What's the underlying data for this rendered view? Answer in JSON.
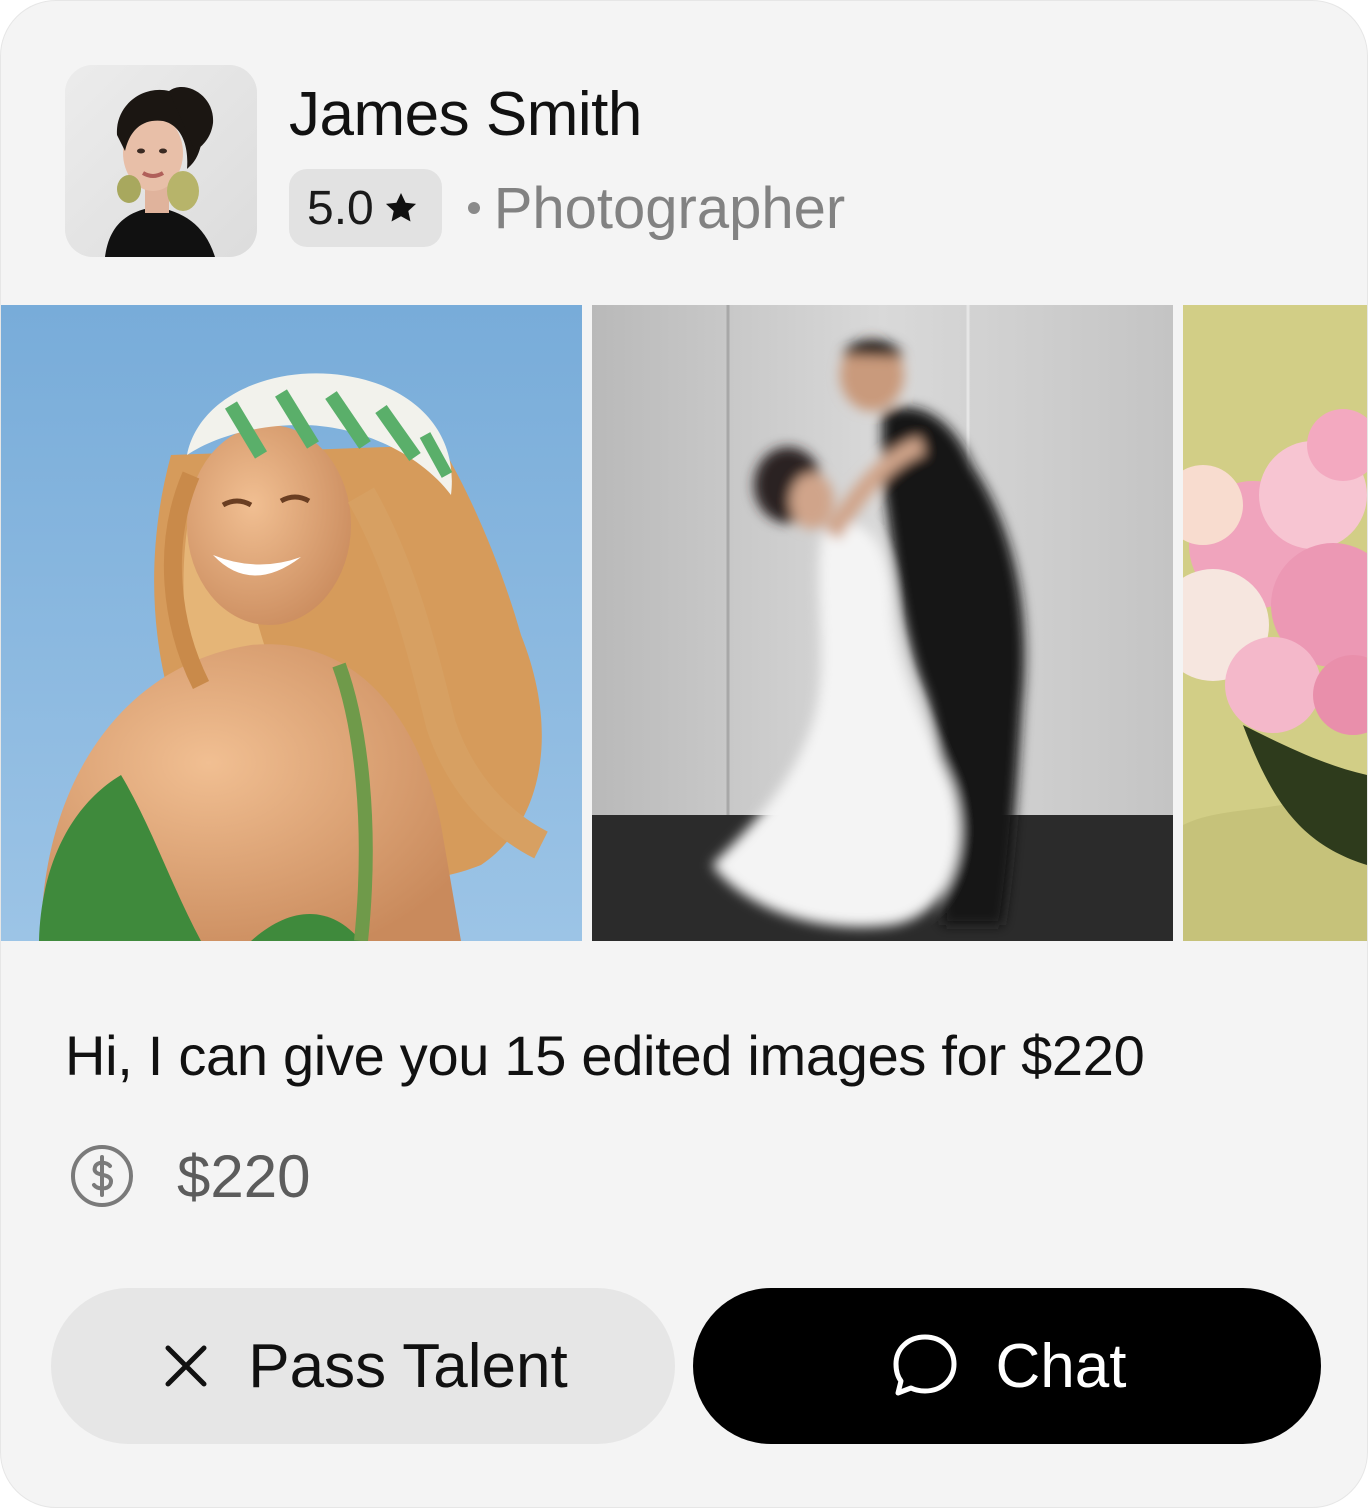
{
  "profile": {
    "name": "James Smith",
    "rating": "5.0",
    "profession": "Photographer"
  },
  "gallery": {
    "photos": [
      {
        "subject": "smiling woman in green striped bandana against blue sky"
      },
      {
        "subject": "blurred wedding couple dancing"
      },
      {
        "subject": "pink and white peonies on yellow-green background"
      }
    ]
  },
  "offer": {
    "message": "Hi, I can give you 15 edited images for $220",
    "price": "$220"
  },
  "actions": {
    "pass_label": "Pass Talent",
    "chat_label": "Chat"
  },
  "icons": {
    "rating": "star-icon",
    "price": "dollar-circle-icon",
    "pass": "close-icon",
    "chat": "chat-bubble-icon"
  },
  "colors": {
    "card_background": "#f4f4f4",
    "chat_button": "#000000",
    "pass_button": "#e6e6e6",
    "muted_text": "#828282"
  }
}
